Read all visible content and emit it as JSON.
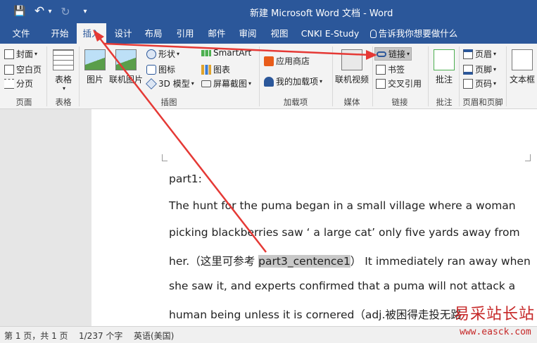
{
  "titlebar": {
    "title": "新建 Microsoft Word 文档 - Word",
    "save_glyph": "💾",
    "undo_glyph": "↶",
    "undo_dropdown": "▾",
    "redo_glyph": "↻",
    "customize_glyph": "▾"
  },
  "tabs": {
    "file": "文件",
    "home": "开始",
    "insert": "插入",
    "design": "设计",
    "layout": "布局",
    "references": "引用",
    "mailings": "邮件",
    "review": "审阅",
    "view": "视图",
    "cnki": "CNKI E-Study",
    "tell_me": "告诉我你想要做什么"
  },
  "ribbon": {
    "pages": {
      "cover": "封面",
      "blank": "空白页",
      "break": "分页",
      "label": "页面"
    },
    "tables": {
      "table": "表格",
      "label": "表格"
    },
    "illustrations": {
      "pictures": "图片",
      "online_pictures": "联机图片",
      "shapes": "形状",
      "icons": "图标",
      "models": "3D 模型",
      "smartart": "SmartArt",
      "chart": "图表",
      "screenshot": "屏幕截图",
      "label": "插图"
    },
    "addins": {
      "store": "应用商店",
      "my_addins": "我的加载项",
      "label": "加载项"
    },
    "media": {
      "online_video": "联机视频",
      "label": "媒体"
    },
    "links": {
      "link": "链接",
      "bookmark": "书签",
      "cross_ref": "交叉引用",
      "label": "链接"
    },
    "comments": {
      "comment": "批注",
      "label": "批注"
    },
    "header_footer": {
      "header": "页眉",
      "footer": "页脚",
      "page_number": "页码",
      "label": "页眉和页脚"
    },
    "text": {
      "textbox": "文本框"
    }
  },
  "document": {
    "line1": "part1:",
    "line2": "The hunt for the puma began in a small village where a woman",
    "line3": "picking blackberries saw ‘  a large cat’  only five yards away from",
    "line4_a": "her.（这里可参考 ",
    "line4_sel": "part3_centence1",
    "line4_b": "）  It immediately ran away when",
    "line5": "she saw it, and experts confirmed that a puma will not attack a",
    "line6": "human being unless it is cornered（adj.被困得走投无路"
  },
  "statusbar": {
    "page": "第 1 页，共 1 页",
    "words": "1/237 个字",
    "language": "英语(美国)"
  },
  "watermark": {
    "cn": "易采站长站",
    "url": "www.easck.com"
  },
  "colors": {
    "title_bar": "#2b579a",
    "ribbon_bg": "#f3f3f3",
    "arrow": "#e53935",
    "watermark": "#c62828"
  }
}
